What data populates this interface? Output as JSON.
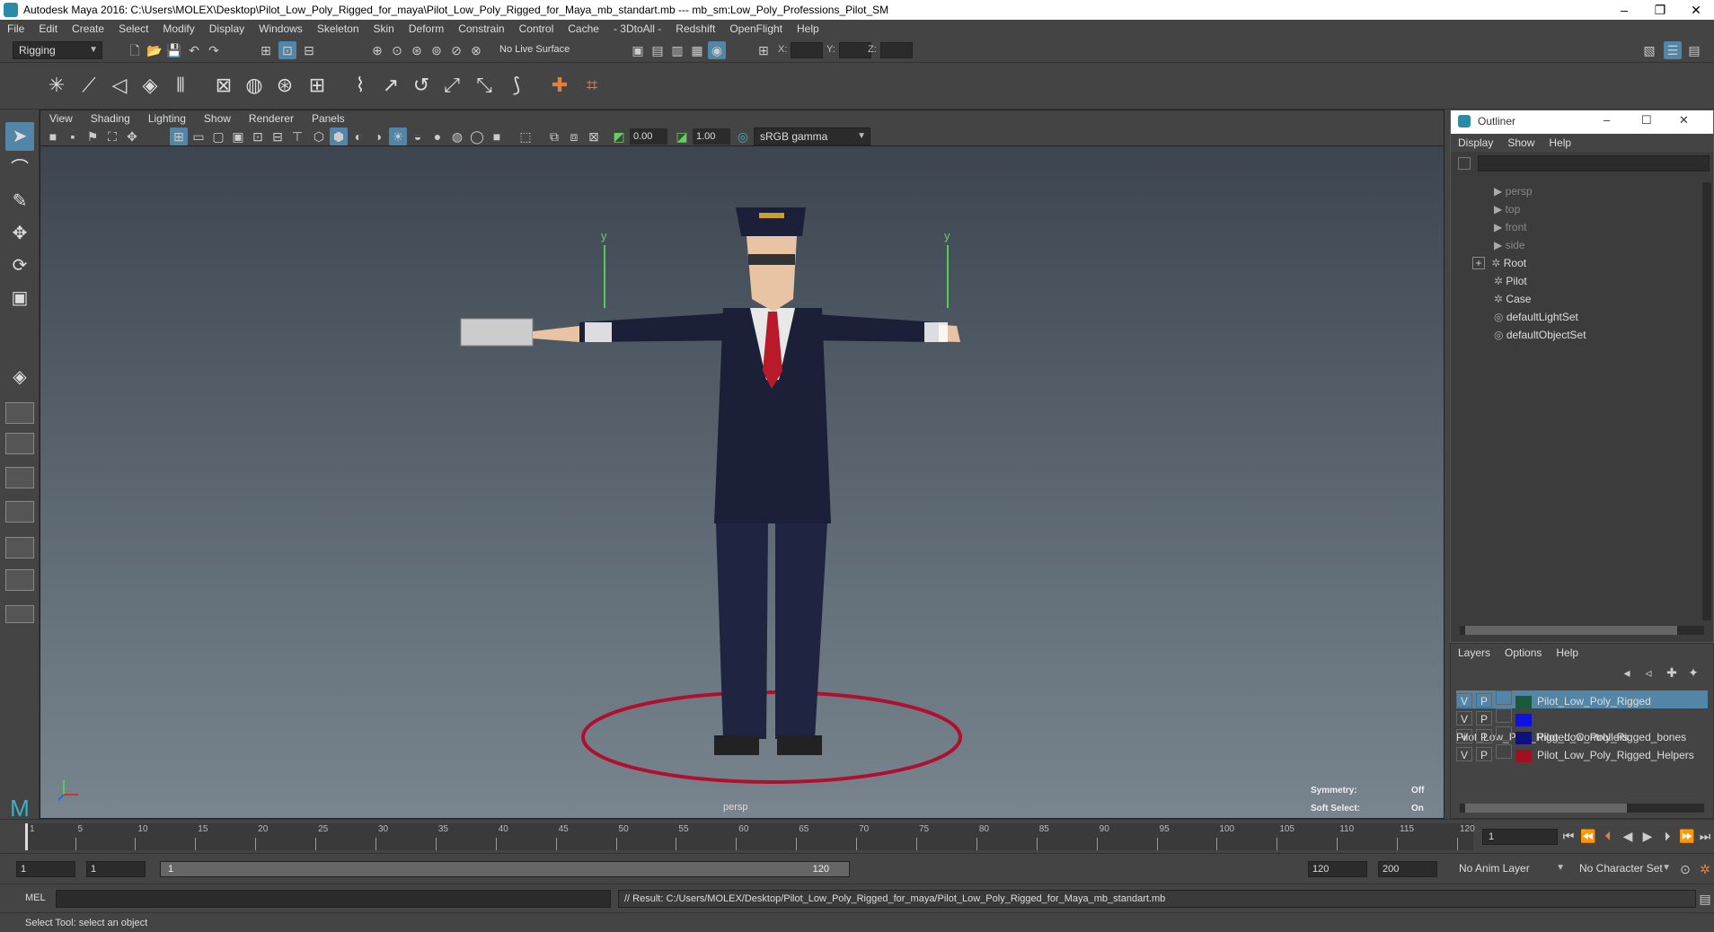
{
  "title": "Autodesk Maya 2016: C:\\Users\\MOLEX\\Desktop\\Pilot_Low_Poly_Rigged_for_maya\\Pilot_Low_Poly_Rigged_for_Maya_mb_standart.mb  ---  mb_sm:Low_Poly_Professions_Pilot_SM",
  "window_controls": {
    "minimize": "–",
    "restore": "❐",
    "close": "✕"
  },
  "menus": [
    "File",
    "Edit",
    "Create",
    "Select",
    "Modify",
    "Display",
    "Windows",
    "Skeleton",
    "Skin",
    "Deform",
    "Constrain",
    "Control",
    "Cache",
    "- 3DtoAll -",
    "Redshift",
    "OpenFlight",
    "Help"
  ],
  "status_line": {
    "mode": "Rigging",
    "live_surface": "No Live Surface",
    "coord_labels": {
      "x": "X:",
      "y": "Y:",
      "z": "Z:"
    }
  },
  "viewport": {
    "menus": [
      "View",
      "Shading",
      "Lighting",
      "Show",
      "Renderer",
      "Panels"
    ],
    "exposure": "0.00",
    "gamma": "1.00",
    "color_space": "sRGB gamma",
    "camera_label": "persp",
    "hud": {
      "symmetry_label": "Symmetry:",
      "symmetry_value": "Off",
      "soft_select_label": "Soft Select:",
      "soft_select_value": "On"
    },
    "axis_y": "y"
  },
  "outliner": {
    "title": "Outliner",
    "menus": [
      "Display",
      "Show",
      "Help"
    ],
    "items": [
      {
        "label": "persp",
        "dim": true
      },
      {
        "label": "top",
        "dim": true
      },
      {
        "label": "front",
        "dim": true
      },
      {
        "label": "side",
        "dim": true
      },
      {
        "label": "Root",
        "dim": false,
        "expand": "+"
      },
      {
        "label": "Pilot",
        "dim": false
      },
      {
        "label": "Case",
        "dim": false
      },
      {
        "label": "defaultLightSet",
        "dim": false
      },
      {
        "label": "defaultObjectSet",
        "dim": false
      }
    ]
  },
  "layers": {
    "menus": [
      "Layers",
      "Options",
      "Help"
    ],
    "rows": [
      {
        "v": "V",
        "p": "P",
        "name": "Pilot_Low_Poly_Rigged",
        "color": "#1a5a3a",
        "selected": true
      },
      {
        "v": "V",
        "p": "P",
        "name": "Pilot_Low_Poly_Rigged_Controllers",
        "color": "#1010e0",
        "selected": false
      },
      {
        "v": "V",
        "p": "P",
        "name": "Pilot_Low_Poly_Rigged_bones",
        "color": "#101080",
        "selected": false
      },
      {
        "v": "V",
        "p": "P",
        "name": "Pilot_Low_Poly_Rigged_Helpers",
        "color": "#a01020",
        "selected": false
      }
    ]
  },
  "timeline": {
    "ticks": [
      "1",
      "5",
      "10",
      "15",
      "20",
      "25",
      "30",
      "35",
      "40",
      "45",
      "50",
      "55",
      "60",
      "65",
      "70",
      "75",
      "80",
      "85",
      "90",
      "95",
      "100",
      "105",
      "110",
      "115",
      "120"
    ],
    "current_frame": "1"
  },
  "range": {
    "start": "1",
    "playback_start": "1",
    "slider_start": "1",
    "slider_end": "120",
    "playback_end": "120",
    "end": "200",
    "anim_layer": "No Anim Layer",
    "character_set": "No Character Set"
  },
  "command": {
    "language": "MEL",
    "result": "// Result: C:/Users/MOLEX/Desktop/Pilot_Low_Poly_Rigged_for_maya/Pilot_Low_Poly_Rigged_for_Maya_mb_standart.mb"
  },
  "help_line": "Select Tool: select an object"
}
